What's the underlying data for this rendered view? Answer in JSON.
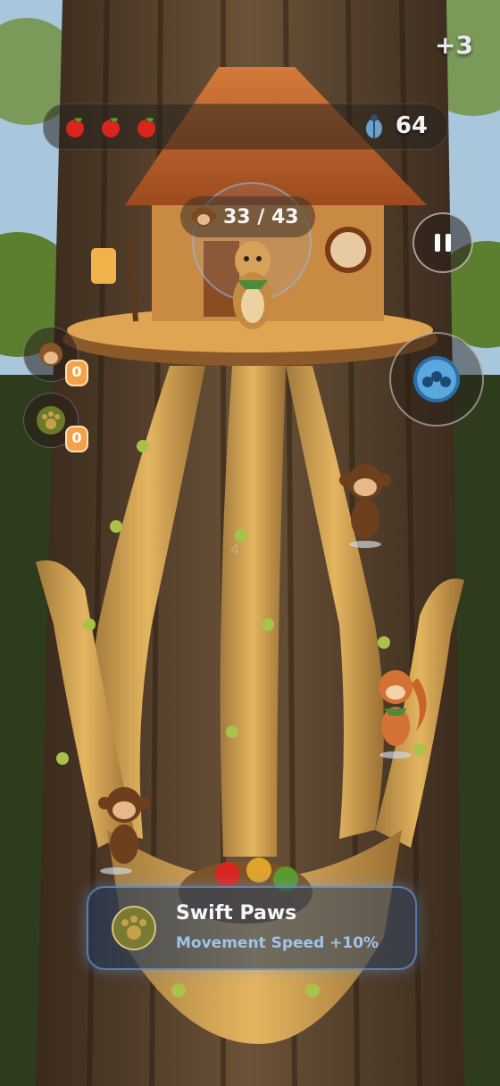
{
  "hud": {
    "bonus_text": "+3",
    "lives": [
      "apple",
      "apple",
      "apple"
    ],
    "score": "64",
    "score_icon": "beetle-icon"
  },
  "monkey_counter": {
    "text": "33 / 43"
  },
  "faint_marker": "4",
  "side_items": [
    {
      "name": "monkey-item",
      "count": "0"
    },
    {
      "name": "paw-item",
      "count": "0"
    }
  ],
  "buff": {
    "title": "Swift Paws",
    "description": "Movement Speed +10%"
  },
  "colors": {
    "accent_blue": "#9fc3ea",
    "badge_orange": "#f4a24a",
    "apple_red": "#d9251f"
  }
}
